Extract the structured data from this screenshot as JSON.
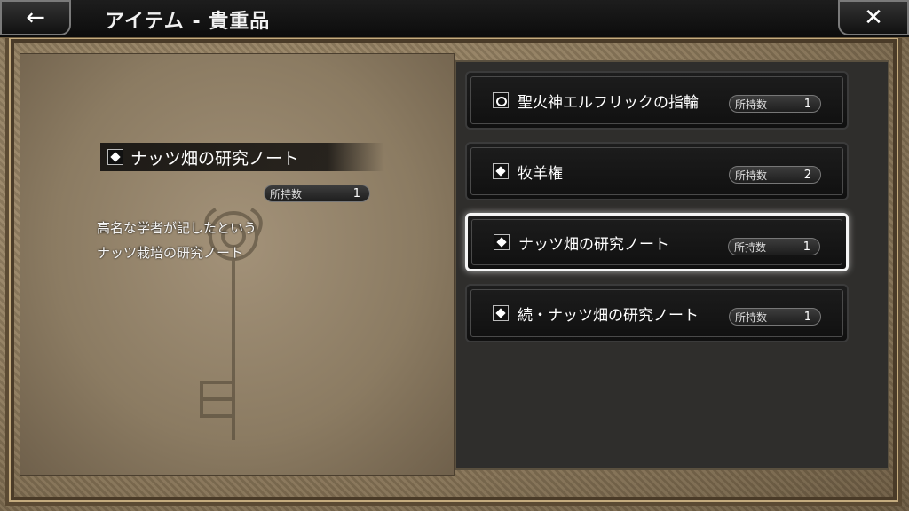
{
  "header": {
    "title": "アイテム - 貴重品",
    "back_glyph": "←",
    "close_glyph": "✕"
  },
  "detail": {
    "name": "ナッツ畑の研究ノート",
    "qty_label": "所持数",
    "qty": "1",
    "description_lines": [
      "高名な学者が記したという",
      "ナッツ栽培の研究ノート"
    ]
  },
  "items": [
    {
      "name": "聖火神エルフリックの指輪",
      "qty_label": "所持数",
      "qty": "1",
      "icon": "ring-icon",
      "selected": false
    },
    {
      "name": "牧羊権",
      "qty_label": "所持数",
      "qty": "2",
      "icon": "diamond-icon",
      "selected": false
    },
    {
      "name": "ナッツ畑の研究ノート",
      "qty_label": "所持数",
      "qty": "1",
      "icon": "diamond-icon",
      "selected": true
    },
    {
      "name": "続・ナッツ畑の研究ノート",
      "qty_label": "所持数",
      "qty": "1",
      "icon": "diamond-icon",
      "selected": false
    }
  ]
}
